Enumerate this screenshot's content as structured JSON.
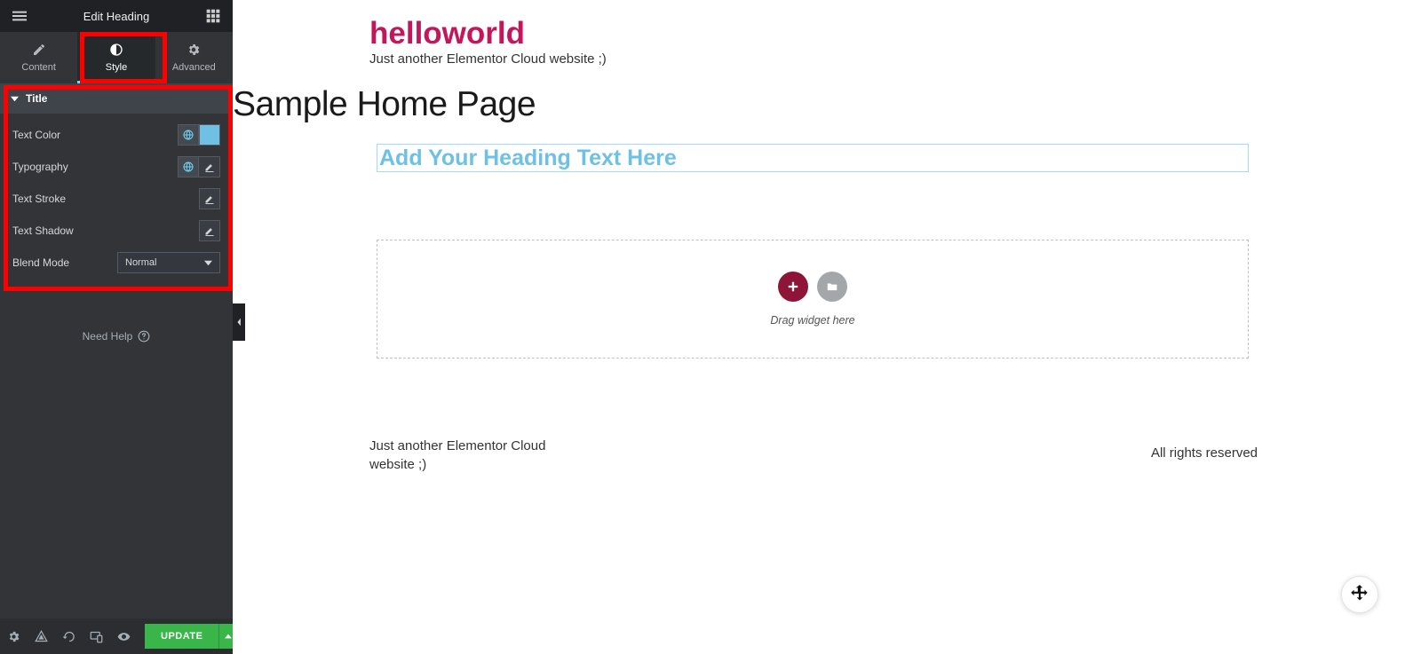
{
  "panel": {
    "title": "Edit Heading",
    "tabs": {
      "content": "Content",
      "style": "Style",
      "advanced": "Advanced"
    },
    "section": "Title",
    "controls": {
      "text_color": "Text Color",
      "color_value": "#6ec1e4",
      "typography": "Typography",
      "text_stroke": "Text Stroke",
      "text_shadow": "Text Shadow",
      "blend_mode": "Blend Mode",
      "blend_mode_value": "Normal"
    },
    "need_help": "Need Help",
    "update": "UPDATE"
  },
  "preview": {
    "site_title": "helloworld",
    "tagline": "Just another Elementor Cloud website ;)",
    "page_title": "Sample Home Page",
    "heading_text": "Add Your Heading Text Here",
    "drop_text": "Drag widget here",
    "footer_left": "Just another Elementor Cloud website ;)",
    "footer_right": "All rights reserved"
  }
}
